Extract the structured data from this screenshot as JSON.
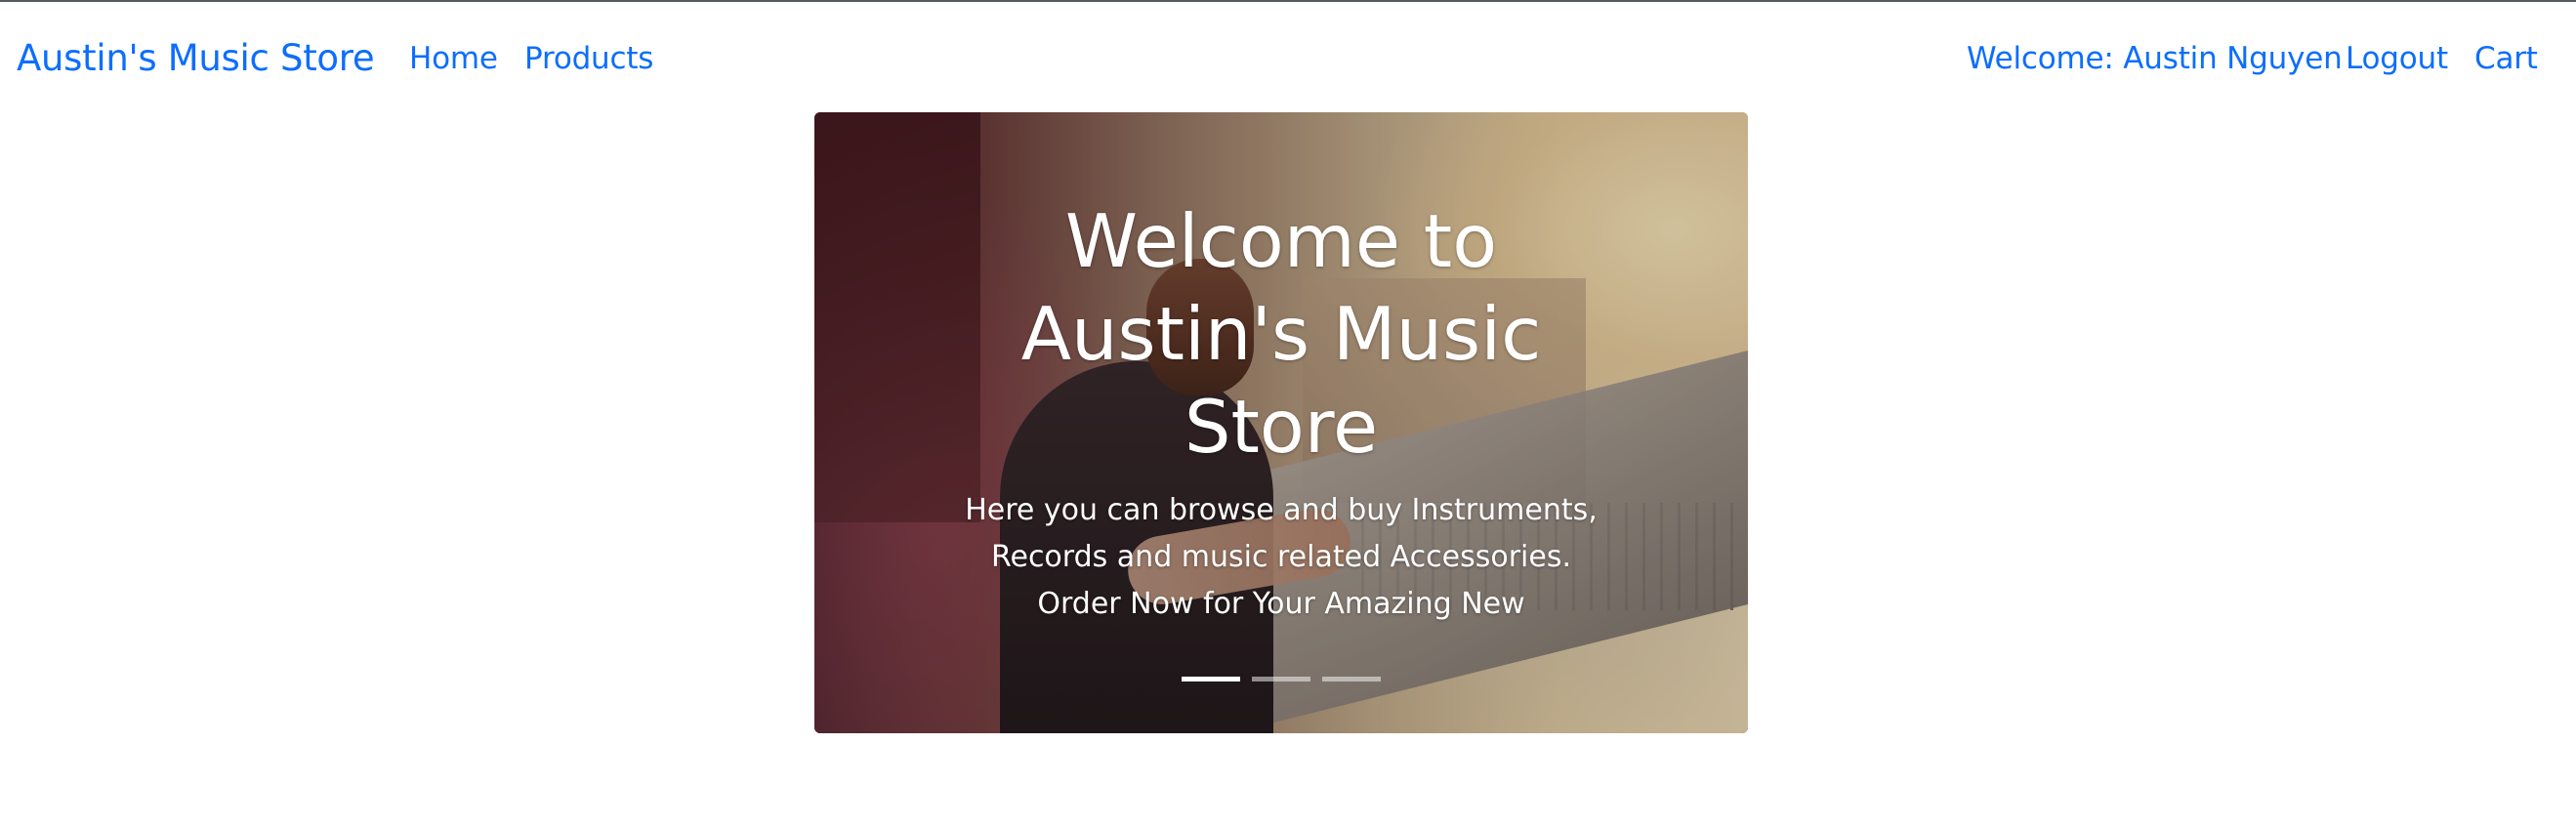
{
  "navbar": {
    "brand": "Austin's Music Store",
    "links": {
      "home": "Home",
      "products": "Products"
    },
    "user": {
      "welcome": "Welcome: Austin Nguyen",
      "logout": "Logout",
      "cart": "Cart"
    }
  },
  "carousel": {
    "active_index": 0,
    "slide_count": 3,
    "caption_title": "Welcome to Austin's Music Store",
    "caption_text": "Here you can browse and buy Instruments, Records and music related Accessories. Order Now for Your Amazing New"
  },
  "colors": {
    "link": "#0d6efd",
    "caption": "#ffffff",
    "top_rule": "#555a60"
  }
}
